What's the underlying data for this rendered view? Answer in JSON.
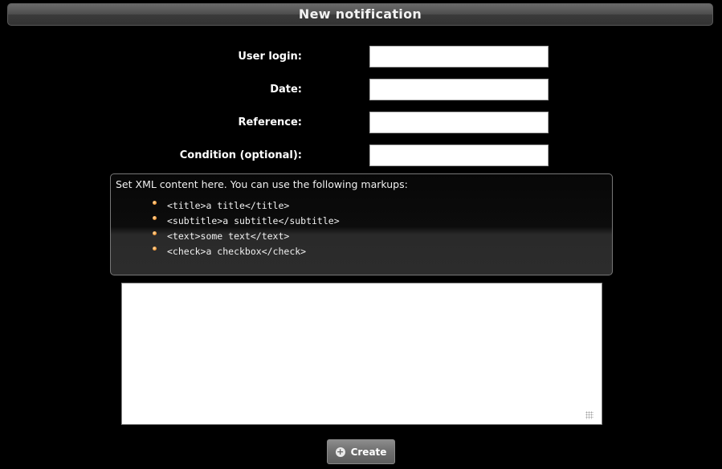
{
  "window": {
    "title": "New notification"
  },
  "form": {
    "fields": [
      {
        "label": "User login:",
        "value": ""
      },
      {
        "label": "Date:",
        "value": ""
      },
      {
        "label": "Reference:",
        "value": ""
      },
      {
        "label": "Condition (optional):",
        "value": ""
      }
    ]
  },
  "info": {
    "text": "Set XML content here. You can use the following markups:",
    "markups": [
      "<title>a title</title>",
      "<subtitle>a subtitle</subtitle>",
      "<text>some text</text>",
      "<check>a checkbox</check>"
    ],
    "bullet_color": "#f5a040"
  },
  "xml_content": {
    "value": ""
  },
  "actions": {
    "create_label": "Create",
    "create_icon": "plus-circle-icon"
  }
}
